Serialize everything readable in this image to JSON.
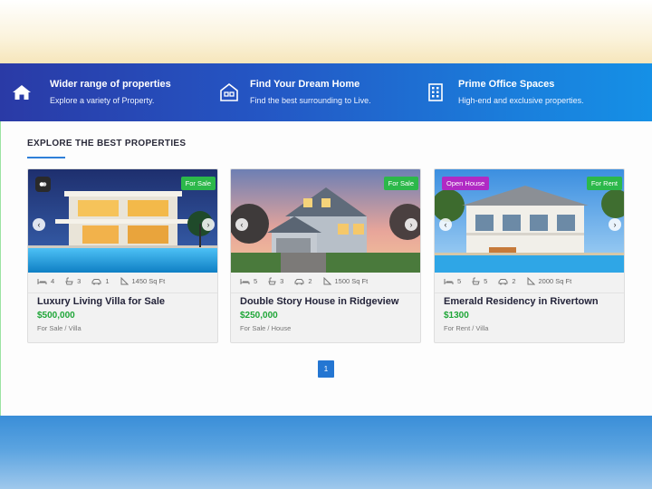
{
  "features": [
    {
      "icon": "home-icon",
      "title": "Wider range of properties",
      "subtitle": "Explore a variety of Property."
    },
    {
      "icon": "house-search-icon",
      "title": "Find Your Dream Home",
      "subtitle": "Find the best surrounding to Live."
    },
    {
      "icon": "office-building-icon",
      "title": "Prime Office Spaces",
      "subtitle": "High-end and exclusive properties."
    }
  ],
  "section": {
    "title": "EXPLORE THE BEST PROPERTIES"
  },
  "cards": [
    {
      "badge": "For Sale",
      "beds": "4",
      "baths": "3",
      "garages": "1",
      "area": "1450 Sq Ft",
      "title": "Luxury Living Villa for Sale",
      "price": "$500,000",
      "category": "For Sale / Villa"
    },
    {
      "badge": "For Sale",
      "beds": "5",
      "baths": "3",
      "garages": "2",
      "area": "1500 Sq Ft",
      "title": "Double Story House in Ridgeview",
      "price": "$250,000",
      "category": "For Sale / House"
    },
    {
      "badge_left": "Open House",
      "badge": "For Rent",
      "beds": "5",
      "baths": "5",
      "garages": "2",
      "area": "2000 Sq Ft",
      "title": "Emerald Residency in Rivertown",
      "price": "$1300",
      "category": "For Rent / Villa"
    }
  ],
  "pagination": {
    "current": "1"
  },
  "colors": {
    "banner_start": "#2a3aa6",
    "banner_end": "#1590e6",
    "price": "#1fa638",
    "badge_sale": "#2cb84a",
    "badge_open": "#b02ac4",
    "pager": "#2476d2"
  }
}
